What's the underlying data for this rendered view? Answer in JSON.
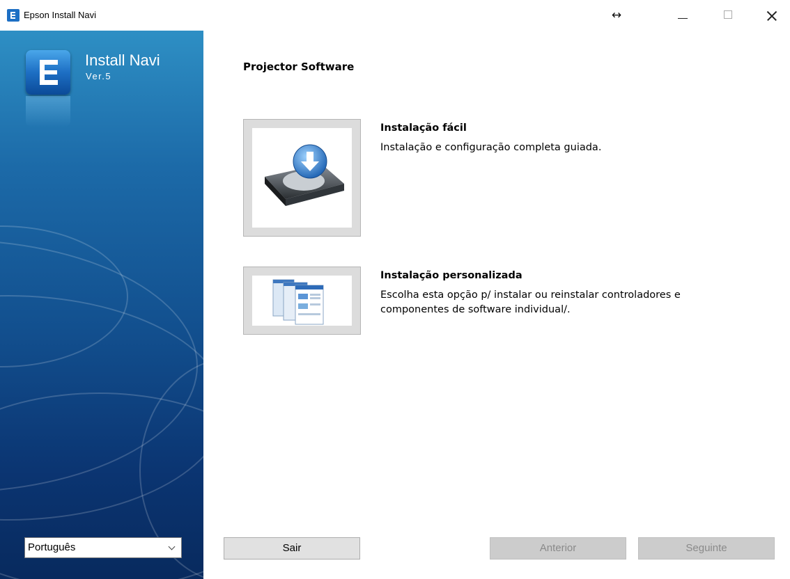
{
  "window": {
    "title": "Epson Install Navi",
    "resize_glyph": "↔"
  },
  "sidebar": {
    "brand_name": "Install Navi",
    "brand_version": "Ver.5",
    "language": "Português"
  },
  "main": {
    "title": "Projector Software",
    "options": [
      {
        "title": "Instalação fácil",
        "description": "Instalação e configuração completa guiada.",
        "icon": "hard-drive-download-icon"
      },
      {
        "title": "Instalação personalizada",
        "description_line1": "Escolha esta opção p/ instalar ou reinstalar controladores e",
        "description_line2": "componentes de software individual/.",
        "icon": "stacked-windows-icon"
      }
    ]
  },
  "footer": {
    "exit_label": "Sair",
    "back_label": "Anterior",
    "next_label": "Seguinte"
  },
  "colors": {
    "sidebar_top": "#2e8fc4",
    "sidebar_bottom": "#082a5e",
    "button_disabled": "#cccccc"
  }
}
